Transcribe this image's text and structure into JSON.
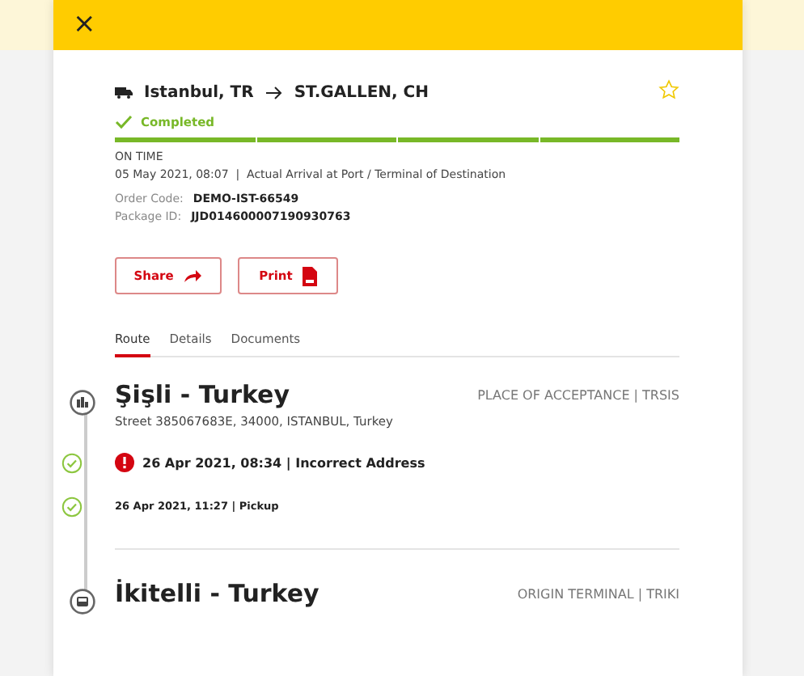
{
  "header": {
    "close": "×"
  },
  "shipment": {
    "origin": "Istanbul, TR",
    "destination": "ST.GALLEN, CH",
    "favorite": false,
    "status": {
      "kind": "completed",
      "label": "Completed"
    },
    "progress": [
      {
        "done": true
      },
      {
        "done": true
      },
      {
        "done": true
      },
      {
        "done": true
      }
    ],
    "timeliness": "ON TIME",
    "last_event": "05 May 2021, 08:07  |  Actual Arrival at Port / Terminal of Destination",
    "fields": [
      {
        "label": "Order Code:",
        "value": "DEMO-IST-66549"
      },
      {
        "label": "Package ID:",
        "value": "JJD014600007190930763"
      }
    ]
  },
  "buttons": [
    {
      "kind": "share",
      "label": "Share"
    },
    {
      "kind": "print",
      "label": "Print"
    }
  ],
  "tabs": [
    {
      "label": "Route",
      "selected": true
    },
    {
      "label": "Details",
      "selected": false
    },
    {
      "label": "Documents",
      "selected": false
    }
  ],
  "stops": [
    {
      "kind": "building",
      "name": "Şişli - Turkey",
      "role": "PLACE OF ACCEPTANCE | TRSIS",
      "address": "Street 385067683E, 34000, ISTANBUL, Turkey",
      "events": [
        {
          "kind": "exception",
          "text": "26 Apr 2021, 08:34 | Incorrect Address",
          "done": true
        },
        {
          "kind": "normal",
          "text": "26 Apr 2021, 11:27 | Pickup",
          "done": true
        }
      ]
    },
    {
      "kind": "terminal",
      "name": "İkitelli - Turkey",
      "role": "ORIGIN TERMINAL | TRIKI"
    }
  ]
}
